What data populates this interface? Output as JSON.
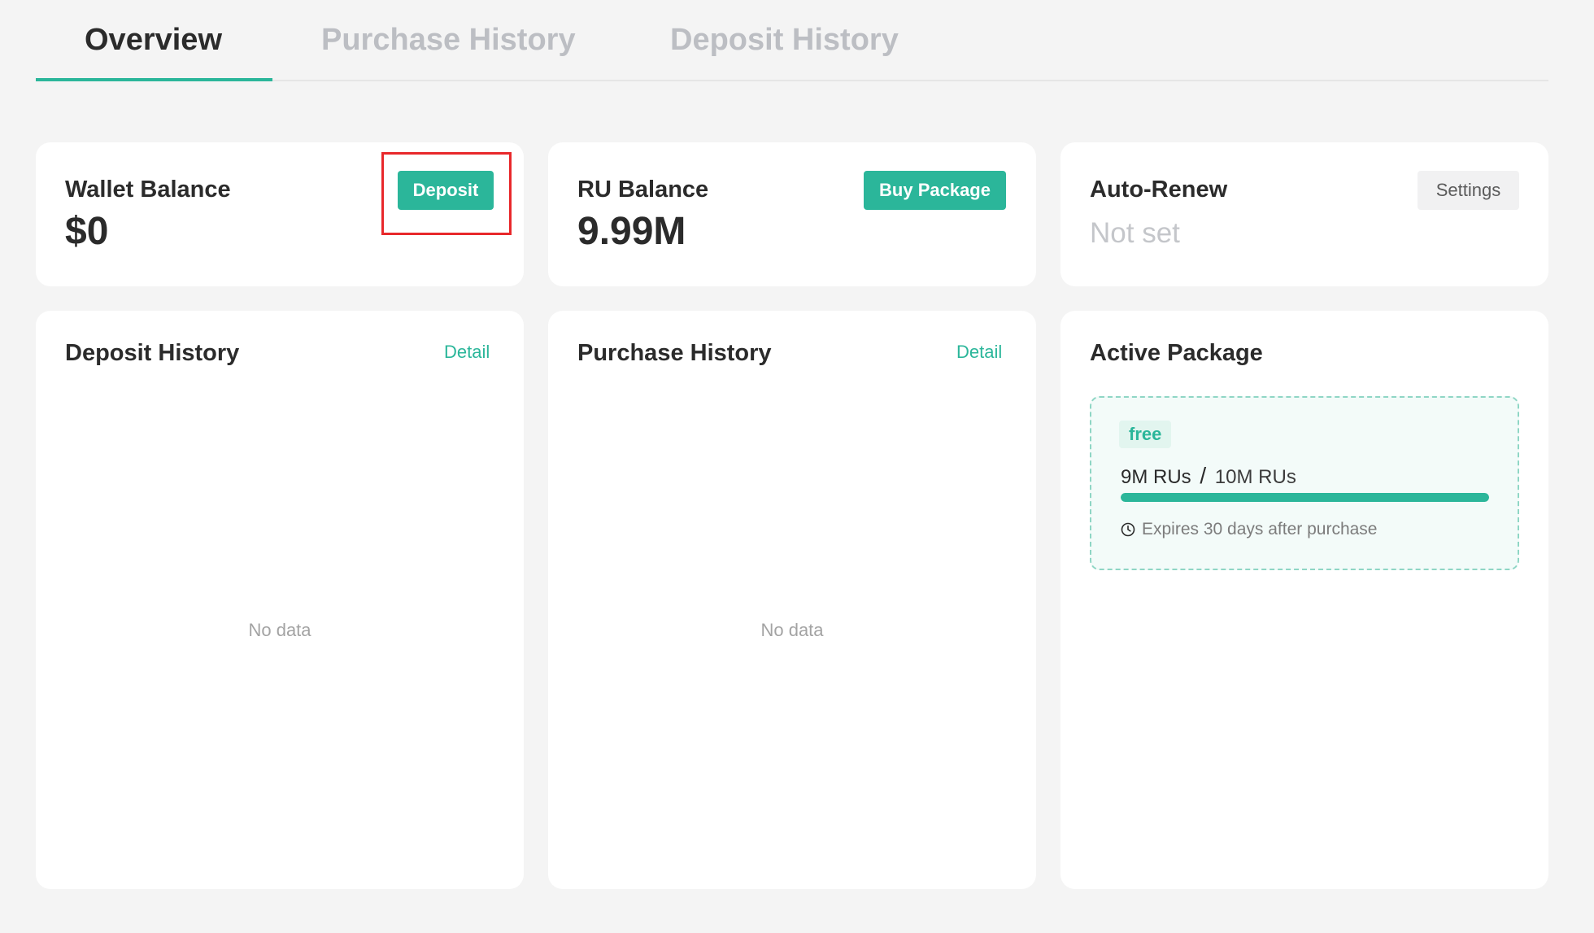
{
  "tabs": [
    {
      "label": "Overview",
      "active": true
    },
    {
      "label": "Purchase History",
      "active": false
    },
    {
      "label": "Deposit History",
      "active": false
    }
  ],
  "wallet": {
    "title": "Wallet Balance",
    "value": "$0",
    "button_label": "Deposit"
  },
  "ru_balance": {
    "title": "RU Balance",
    "value": "9.99M",
    "button_label": "Buy Package"
  },
  "auto_renew": {
    "title": "Auto-Renew",
    "value": "Not set",
    "button_label": "Settings"
  },
  "deposit_history": {
    "title": "Deposit History",
    "link_label": "Detail",
    "empty_text": "No data"
  },
  "purchase_history": {
    "title": "Purchase History",
    "link_label": "Detail",
    "empty_text": "No data"
  },
  "active_package": {
    "title": "Active Package",
    "badge": "free",
    "used": "9M RUs",
    "separator": "/",
    "total": "10M RUs",
    "progress_percent": 100,
    "expiry_text": "Expires 30 days after purchase"
  },
  "colors": {
    "accent": "#2bb69a",
    "highlight": "#e8282b",
    "background": "#f4f4f4"
  },
  "icons": {
    "expiry": "clock-icon"
  }
}
